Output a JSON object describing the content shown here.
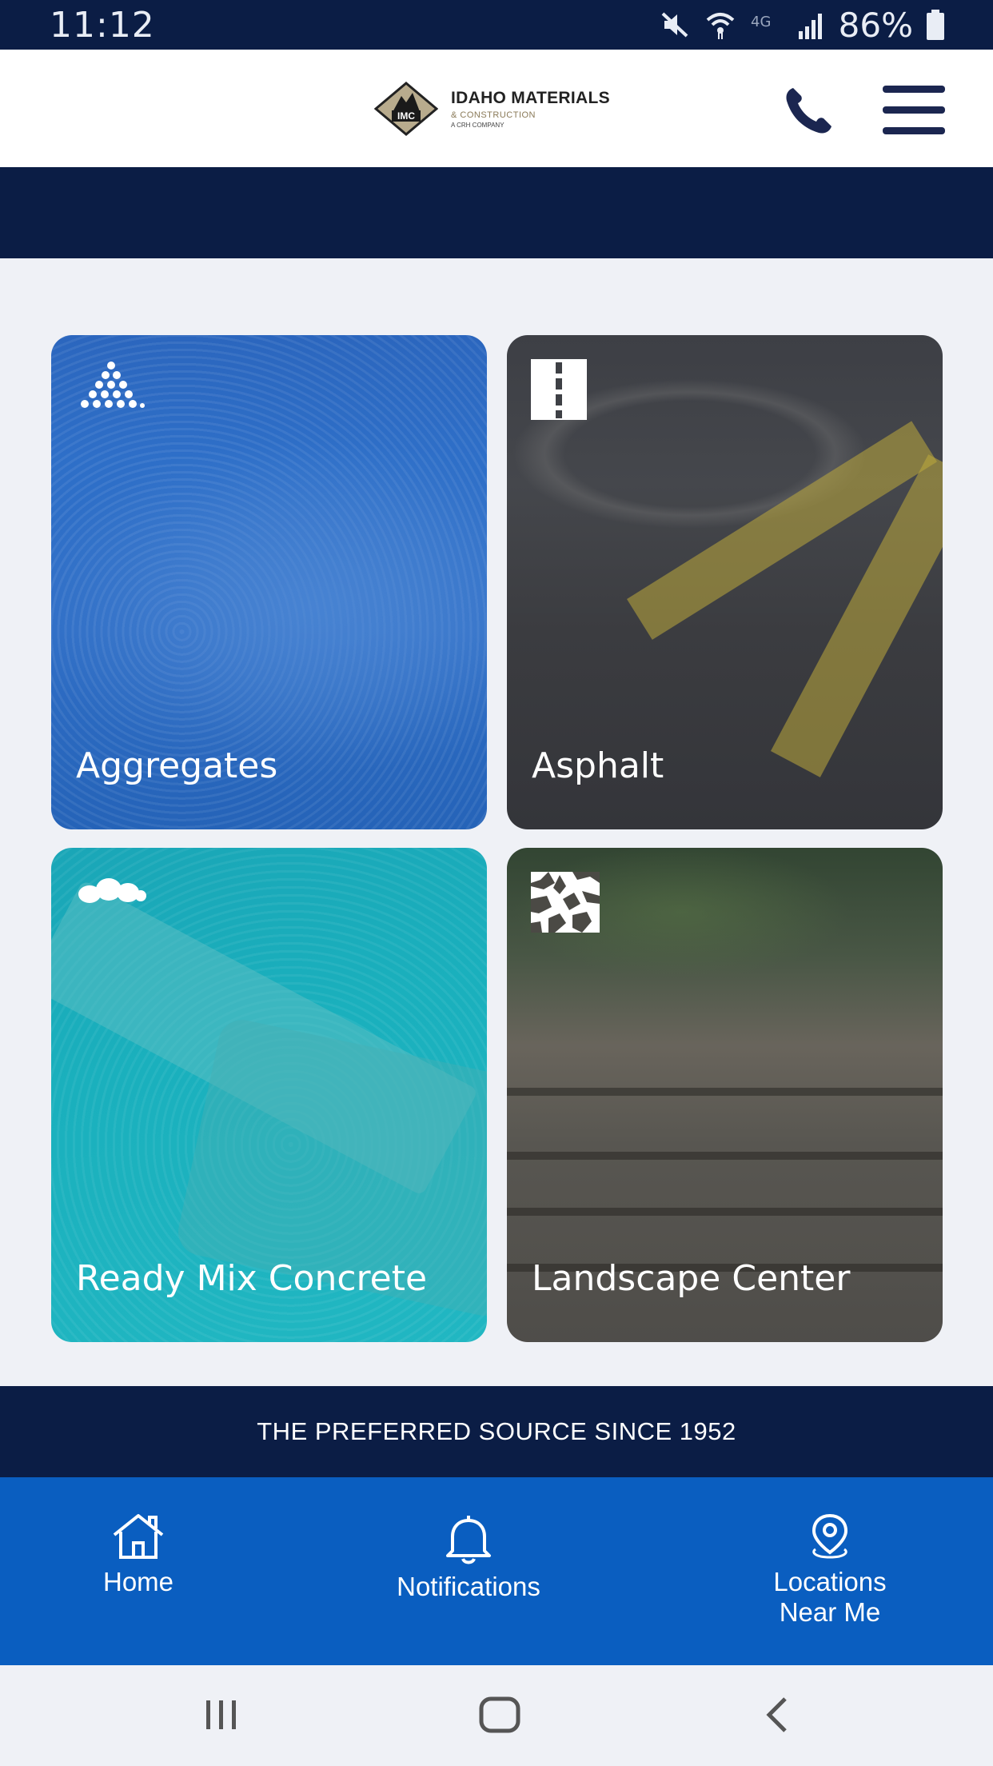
{
  "status_bar": {
    "time": "11:12",
    "battery": "86%",
    "icons": [
      "mute-icon",
      "wifi-icon",
      "4g-icon",
      "signal-icon",
      "battery-icon"
    ]
  },
  "header": {
    "logo": {
      "badge": "IMC",
      "name": "IDAHO MATERIALS",
      "subtitle": "& CONSTRUCTION",
      "parent": "A CRH COMPANY"
    },
    "phone_icon": "phone-icon",
    "menu_icon": "hamburger-icon"
  },
  "tiles": [
    {
      "label": "Aggregates",
      "icon": "aggregates-pile-icon",
      "tint": "#2d6cc4"
    },
    {
      "label": "Asphalt",
      "icon": "road-icon",
      "tint": "#3e4045"
    },
    {
      "label": "Ready Mix Concrete",
      "icon": "concrete-icon",
      "tint": "#1bb0be"
    },
    {
      "label": "Landscape Center",
      "icon": "stone-paver-icon",
      "tint": "#4b4a45"
    }
  ],
  "tagline": "THE PREFERRED SOURCE SINCE 1952",
  "bottom_nav": {
    "home": "Home",
    "notifications": "Notifications",
    "locations_line1": "Locations",
    "locations_line2": "Near Me"
  },
  "colors": {
    "navy": "#0b1d45",
    "nav_blue": "#0a5ec0",
    "page_bg": "#eff1f6"
  }
}
